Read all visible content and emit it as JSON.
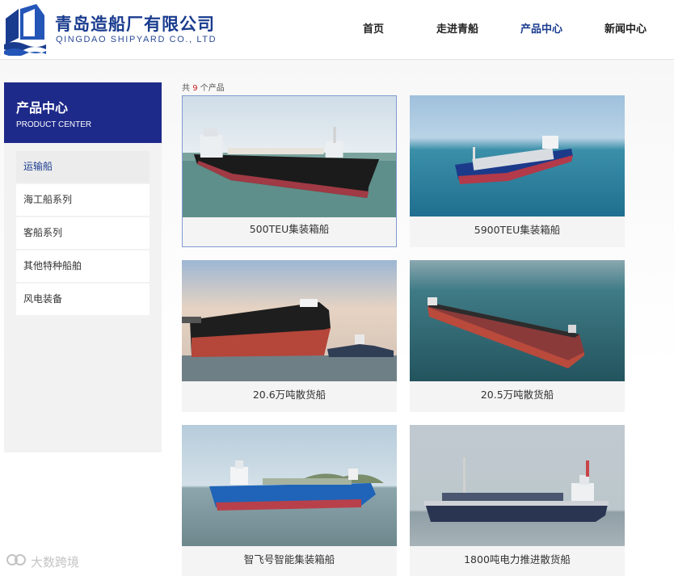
{
  "brand": {
    "name_cn": "青岛造船厂有限公司",
    "name_en": "QINGDAO SHIPYARD CO., LTD"
  },
  "nav": {
    "items": [
      {
        "label": "首页"
      },
      {
        "label": "走进青船"
      },
      {
        "label": "产品中心"
      },
      {
        "label": "新闻中心"
      }
    ],
    "active_index": 2
  },
  "sidebar": {
    "title_cn": "产品中心",
    "title_en": "PRODUCT CENTER",
    "items": [
      {
        "label": "运输船"
      },
      {
        "label": "海工船系列"
      },
      {
        "label": "客船系列"
      },
      {
        "label": "其他特种船舶"
      },
      {
        "label": "风电装备"
      }
    ],
    "active_index": 0
  },
  "products": {
    "count_prefix": "共",
    "count": "9",
    "count_suffix": "个产品",
    "items": [
      {
        "caption": "500TEU集装箱船",
        "scene": "container-beige"
      },
      {
        "caption": "5900TEU集装箱船",
        "scene": "container-blue"
      },
      {
        "caption": "20.6万吨散货船",
        "scene": "bulk-dock"
      },
      {
        "caption": "20.5万吨散货船",
        "scene": "bulk-sea"
      },
      {
        "caption": "智飞号智能集装箱船",
        "scene": "smart-container"
      },
      {
        "caption": "1800吨电力推进散货船",
        "scene": "small-bulk"
      }
    ]
  },
  "watermark": {
    "text": "大数跨境"
  },
  "colors": {
    "brand_blue": "#1a3c8f",
    "sidebar_head": "#1e2a8a",
    "count_red": "#c81e1e"
  }
}
